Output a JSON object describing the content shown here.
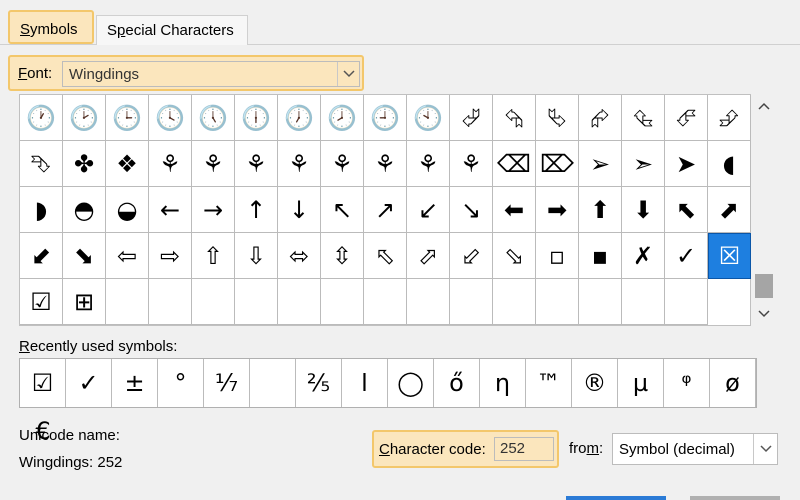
{
  "tabs": {
    "symbols": {
      "mnemonic": "S",
      "rest": "ymbols"
    },
    "special": {
      "pre": "S",
      "mnemonic": "p",
      "rest": "ecial Characters"
    }
  },
  "font": {
    "label_mnemonic": "F",
    "label_rest": "ont:",
    "value": "Wingdings"
  },
  "symbol_grid": {
    "cells": [
      "🕐",
      "🕑",
      "🕒",
      "🕓",
      "🕔",
      "🕕",
      "🕖",
      "🕗",
      "🕘",
      "🕙",
      "⮰",
      "⮲",
      "⮱",
      "⮳",
      "⮴",
      "⮶",
      "⮵",
      "⮷",
      "✤",
      "❖",
      "⚘",
      "⚘",
      "⚘",
      "⚘",
      "⚘",
      "⚘",
      "⚘",
      "⚘",
      "⌫",
      "⌦",
      "➢",
      "➣",
      "➤",
      "◖",
      "◗",
      "◓",
      "◒",
      "←",
      "→",
      "↑",
      "↓",
      "↖",
      "↗",
      "↙",
      "↘",
      "⬅",
      "➡",
      "⬆",
      "⬇",
      "⬉",
      "⬈",
      "⬋",
      "⬊",
      "⇦",
      "⇨",
      "⇧",
      "⇩",
      "⬄",
      "⇳",
      "⬁",
      "⬀",
      "⬃",
      "⬂",
      "▫",
      "▪",
      "✗",
      "✓",
      "☒",
      "☑",
      "⊞",
      "",
      "",
      "",
      "",
      "",
      "",
      "",
      "",
      "",
      "",
      "",
      "",
      "",
      ""
    ],
    "selected_index": 67
  },
  "recent": {
    "label_mnemonic": "R",
    "label_rest": "ecently used symbols:",
    "items": [
      "☑",
      "✓",
      "±",
      "°",
      "⅐",
      "",
      "⅖",
      "ا",
      "◯",
      "ő",
      "η",
      "™",
      "®",
      "µ",
      "ᵠ",
      "ø"
    ]
  },
  "recent_extra": "€",
  "unicode": {
    "label": "Unicode name:",
    "value": "Wingdings: 252"
  },
  "char_code": {
    "label_mnemonic": "C",
    "label_rest": "haracter code:",
    "value": "252"
  },
  "from": {
    "label_pre": "fro",
    "label_mnemonic": "m",
    "label_rest": ":",
    "value": "Symbol (decimal)"
  },
  "colors": {
    "highlight": "#fbe6bd",
    "highlight_border": "#f3c76b",
    "selection": "#1e7fe0"
  }
}
